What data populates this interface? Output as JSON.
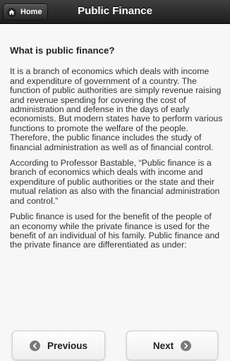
{
  "header": {
    "home_label": "Home",
    "title": "Public Finance"
  },
  "content": {
    "heading": "What is public finance?",
    "paragraphs": [
      "It is a branch of economics which deals with income and expenditure of government of a country. The function of public authorities are simply revenue raising and revenue spending for covering the cost of administration and defense in the days of early economists. But modern states have to perform various functions to promote the welfare of the people. Therefore, the public finance includes the study of financial administration as well as of financial control.",
      "According to Professor Bastable, “Public finance is a branch of economics which deals with income and expenditure of public authorities or the state and their mutual relation as also with the financial administration and control.”",
      "Public finance is used for the benefit of the people of an economy while the private finance is used for the benefit of an individual of his family. Public finance and the private finance are differentiated as under:"
    ]
  },
  "footer": {
    "previous_label": "Previous",
    "next_label": "Next"
  },
  "icons": {
    "home": "home-icon",
    "previous": "chevron-left-circle-icon",
    "next": "chevron-right-circle-icon"
  }
}
